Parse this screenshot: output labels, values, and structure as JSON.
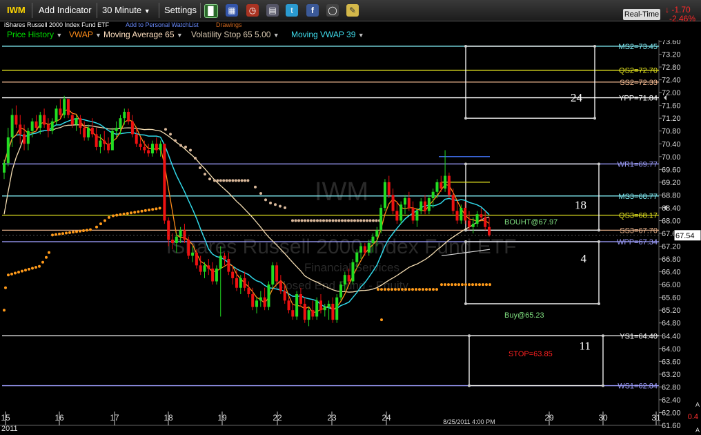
{
  "toolbar": {
    "symbol": "IWM",
    "add_indicator": "Add Indicator",
    "interval": "30 Minute",
    "settings": "Settings",
    "realtime": "Real-Time",
    "change": "-1.70",
    "change_pct": "-2.46%"
  },
  "info": {
    "name": "iShares Russell 2000 Index Fund ETF",
    "watchlist": "Add to Personal WatchList",
    "drawings": "Drawings"
  },
  "indicators": [
    {
      "label": "Price History",
      "color": "#00e000"
    },
    {
      "label": "VWAP",
      "color": "#ff8c1a"
    },
    {
      "label": "Moving Average 65",
      "color": "#ffe0c0"
    },
    {
      "label": "Volatility Stop 65 5.00",
      "color": "#d8c8b0"
    },
    {
      "label": "Moving VWAP 39",
      "color": "#40e0f0"
    }
  ],
  "colors": {
    "up": "#22dd22",
    "down": "#ee1111",
    "vwap": "#ff8c1a",
    "ma": "#f5deb3",
    "mvwap": "#30d8e8",
    "vstop_high": "#d9b89a",
    "vstop_low": "#ff9a1a",
    "cyan": "#7fe8f0",
    "yellow": "#e8e820",
    "peach": "#f0b890",
    "lavender": "#a0a0ff",
    "white": "#ffffff",
    "green_text": "#80e080",
    "stop": "#ff2020"
  },
  "chart_data": {
    "type": "candlestick",
    "symbol": "IWM",
    "watermark": "IWM",
    "watermark_name": "iShares Russell 2000 Index Fund ETF",
    "watermark_sector": "Financial Services",
    "watermark_category": "Closed End Fund - Equity",
    "x_tick_labels": [
      "15",
      "16",
      "17",
      "18",
      "19",
      "22",
      "23",
      "24",
      "29",
      "30",
      "31"
    ],
    "x_tick_year": "2011",
    "current_time_label": "8/25/2011 4:00 PM",
    "ylim": [
      61.6,
      73.6
    ],
    "y_ticks": [
      61.6,
      62.0,
      62.4,
      62.8,
      63.2,
      63.6,
      64.0,
      64.4,
      64.8,
      65.2,
      65.6,
      66.0,
      66.4,
      66.8,
      67.2,
      67.6,
      68.0,
      68.4,
      68.8,
      69.2,
      69.6,
      70.0,
      70.4,
      70.8,
      71.2,
      71.6,
      72.0,
      72.4,
      72.8,
      73.2,
      73.6
    ],
    "last_price": "67.54",
    "right_axis_partial": [
      "0.4",
      "A",
      "A"
    ],
    "levels": [
      {
        "label": "MS2=73.45",
        "value": 73.45,
        "color": "cyan"
      },
      {
        "label": "QS2=72.70",
        "value": 72.7,
        "color": "yellow"
      },
      {
        "label": "SS2=72.33",
        "value": 72.33,
        "color": "peach"
      },
      {
        "label": "YPP=71.84",
        "value": 71.84,
        "color": "white"
      },
      {
        "label": "WR1=69.77",
        "value": 69.77,
        "color": "lavender"
      },
      {
        "label": "MS3=68.77",
        "value": 68.77,
        "color": "cyan"
      },
      {
        "label": "QS3=68.17",
        "value": 68.17,
        "color": "yellow"
      },
      {
        "label": "SS3=67.70",
        "value": 67.7,
        "color": "peach"
      },
      {
        "label": "WPP=67.34",
        "value": 67.34,
        "color": "lavender"
      },
      {
        "label": "YS1=64.40",
        "value": 64.4,
        "color": "white"
      },
      {
        "label": "WS1=62.84",
        "value": 62.84,
        "color": "lavender"
      }
    ],
    "boxes": [
      {
        "number": "24",
        "top": 73.45,
        "bottom": 71.2
      },
      {
        "number": "18",
        "top": 69.77,
        "bottom": 67.7
      },
      {
        "number": "4",
        "top": 67.34,
        "bottom": 65.4
      },
      {
        "number": "11",
        "top": 64.4,
        "bottom": 62.84
      }
    ],
    "annotations": [
      {
        "text": "BOUHT@67.97",
        "price": 67.97,
        "color": "green_text"
      },
      {
        "text": "Buy@65.23",
        "price": 65.23,
        "color": "green_text"
      },
      {
        "text": "STOP=63.85",
        "price": 63.85,
        "color": "stop"
      }
    ],
    "candles": [
      [
        69.5,
        69.9,
        69.3,
        69.8
      ],
      [
        69.8,
        70.9,
        69.7,
        70.6
      ],
      [
        70.6,
        71.5,
        70.3,
        71.3
      ],
      [
        71.3,
        71.6,
        70.9,
        71.0
      ],
      [
        71.0,
        71.3,
        70.4,
        70.7
      ],
      [
        70.7,
        71.0,
        70.2,
        70.4
      ],
      [
        70.4,
        70.9,
        70.2,
        70.8
      ],
      [
        70.8,
        71.2,
        70.6,
        71.1
      ],
      [
        71.1,
        71.3,
        70.8,
        70.9
      ],
      [
        70.9,
        71.4,
        70.7,
        71.3
      ],
      [
        71.3,
        71.5,
        70.9,
        71.0
      ],
      [
        71.0,
        71.2,
        70.6,
        70.8
      ],
      [
        70.8,
        71.2,
        70.7,
        71.1
      ],
      [
        71.1,
        71.6,
        71.0,
        71.5
      ],
      [
        71.5,
        71.8,
        71.2,
        71.3
      ],
      [
        71.3,
        71.9,
        71.2,
        71.8
      ],
      [
        71.8,
        71.8,
        71.2,
        71.3
      ],
      [
        71.3,
        71.4,
        70.9,
        71.0
      ],
      [
        71.0,
        71.3,
        70.8,
        71.2
      ],
      [
        71.2,
        71.3,
        70.7,
        70.9
      ],
      [
        70.9,
        71.1,
        70.5,
        70.6
      ],
      [
        70.6,
        71.0,
        70.5,
        70.9
      ],
      [
        70.9,
        71.2,
        70.6,
        70.7
      ],
      [
        70.7,
        70.9,
        70.2,
        70.3
      ],
      [
        70.3,
        70.7,
        70.1,
        70.5
      ],
      [
        70.5,
        70.8,
        70.2,
        70.4
      ],
      [
        70.4,
        70.6,
        70.1,
        70.2
      ],
      [
        70.2,
        70.9,
        70.2,
        70.8
      ],
      [
        70.8,
        71.1,
        70.6,
        70.9
      ],
      [
        70.9,
        71.3,
        70.7,
        71.2
      ],
      [
        71.2,
        71.5,
        71.0,
        71.4
      ],
      [
        71.4,
        71.5,
        71.0,
        71.1
      ],
      [
        71.1,
        71.3,
        70.6,
        70.7
      ],
      [
        70.7,
        70.9,
        70.3,
        70.4
      ],
      [
        70.4,
        70.6,
        70.2,
        70.3
      ],
      [
        70.3,
        70.5,
        70.1,
        70.2
      ],
      [
        70.2,
        70.4,
        70.0,
        70.1
      ],
      [
        70.1,
        70.5,
        70.0,
        70.4
      ],
      [
        70.4,
        70.6,
        70.1,
        70.2
      ],
      [
        70.2,
        70.5,
        70.0,
        70.4
      ],
      [
        70.4,
        70.4,
        67.9,
        68.0
      ],
      [
        68.0,
        68.1,
        67.2,
        67.4
      ],
      [
        67.4,
        67.6,
        67.1,
        67.3
      ],
      [
        67.3,
        67.6,
        67.0,
        67.5
      ],
      [
        67.5,
        67.8,
        67.3,
        67.7
      ],
      [
        67.7,
        67.9,
        67.3,
        67.4
      ],
      [
        67.4,
        67.5,
        66.8,
        66.9
      ],
      [
        66.9,
        67.2,
        66.7,
        67.0
      ],
      [
        67.0,
        67.1,
        66.5,
        66.6
      ],
      [
        66.6,
        66.9,
        66.3,
        66.4
      ],
      [
        66.4,
        66.7,
        66.2,
        66.6
      ],
      [
        66.6,
        66.8,
        66.3,
        66.5
      ],
      [
        66.5,
        66.7,
        66.0,
        66.1
      ],
      [
        66.1,
        66.6,
        66.0,
        66.5
      ],
      [
        66.5,
        67.2,
        65.0,
        66.9
      ],
      [
        66.9,
        67.0,
        66.6,
        66.8
      ],
      [
        66.8,
        67.0,
        66.3,
        66.4
      ],
      [
        66.4,
        66.6,
        66.0,
        66.2
      ],
      [
        66.2,
        66.5,
        65.8,
        65.9
      ],
      [
        65.9,
        66.3,
        65.7,
        66.2
      ],
      [
        66.2,
        66.4,
        65.8,
        65.9
      ],
      [
        65.9,
        66.1,
        65.6,
        65.7
      ],
      [
        65.7,
        65.9,
        65.2,
        65.3
      ],
      [
        65.3,
        65.6,
        65.1,
        65.5
      ],
      [
        65.5,
        65.8,
        65.3,
        65.6
      ],
      [
        65.6,
        65.9,
        65.2,
        65.3
      ],
      [
        65.3,
        66.1,
        65.2,
        66.0
      ],
      [
        66.0,
        66.7,
        65.9,
        66.6
      ],
      [
        66.6,
        66.7,
        66.0,
        66.1
      ],
      [
        66.1,
        66.3,
        65.7,
        65.8
      ],
      [
        65.8,
        66.0,
        65.4,
        65.5
      ],
      [
        65.5,
        65.6,
        65.1,
        65.2
      ],
      [
        65.2,
        65.4,
        64.9,
        65.0
      ],
      [
        65.0,
        65.8,
        64.9,
        65.7
      ],
      [
        65.7,
        65.9,
        65.3,
        65.4
      ],
      [
        65.4,
        65.6,
        64.8,
        64.9
      ],
      [
        64.9,
        65.3,
        64.7,
        65.2
      ],
      [
        65.2,
        65.5,
        64.9,
        65.0
      ],
      [
        65.0,
        65.6,
        64.9,
        65.5
      ],
      [
        65.5,
        65.7,
        65.1,
        65.2
      ],
      [
        65.2,
        65.4,
        65.0,
        65.3
      ],
      [
        65.3,
        65.5,
        64.9,
        65.4
      ],
      [
        65.4,
        65.6,
        64.8,
        64.9
      ],
      [
        64.9,
        65.7,
        64.8,
        65.6
      ],
      [
        65.6,
        66.1,
        65.5,
        66.0
      ],
      [
        66.0,
        66.4,
        65.8,
        66.3
      ],
      [
        66.3,
        66.5,
        66.0,
        66.1
      ],
      [
        66.1,
        66.8,
        66.0,
        66.7
      ],
      [
        66.7,
        67.1,
        66.5,
        67.0
      ],
      [
        67.0,
        67.3,
        66.8,
        67.2
      ],
      [
        67.2,
        67.3,
        66.9,
        67.0
      ],
      [
        67.0,
        67.4,
        66.9,
        67.3
      ],
      [
        67.3,
        67.6,
        67.0,
        67.5
      ],
      [
        67.5,
        67.8,
        67.2,
        67.7
      ],
      [
        67.7,
        68.5,
        67.6,
        68.4
      ],
      [
        68.4,
        69.3,
        68.3,
        69.2
      ],
      [
        69.2,
        69.4,
        68.7,
        68.8
      ],
      [
        68.8,
        69.0,
        68.2,
        68.3
      ],
      [
        68.3,
        68.6,
        67.9,
        68.0
      ],
      [
        68.0,
        68.6,
        67.9,
        68.5
      ],
      [
        68.5,
        68.8,
        68.2,
        68.7
      ],
      [
        68.7,
        68.9,
        68.3,
        68.4
      ],
      [
        68.4,
        68.6,
        67.9,
        68.0
      ],
      [
        68.0,
        68.4,
        67.8,
        68.3
      ],
      [
        68.3,
        68.7,
        68.2,
        68.6
      ],
      [
        68.6,
        68.8,
        68.2,
        68.3
      ],
      [
        68.3,
        68.8,
        68.2,
        68.7
      ],
      [
        68.7,
        69.0,
        68.4,
        68.9
      ],
      [
        68.9,
        69.3,
        68.7,
        69.2
      ],
      [
        69.2,
        69.4,
        68.9,
        69.0
      ],
      [
        69.0,
        70.2,
        68.9,
        69.4
      ],
      [
        69.4,
        69.5,
        68.7,
        68.8
      ],
      [
        68.8,
        69.0,
        68.2,
        68.3
      ],
      [
        68.3,
        68.6,
        67.9,
        68.0
      ],
      [
        68.0,
        68.5,
        67.9,
        68.4
      ],
      [
        68.4,
        68.6,
        67.9,
        68.0
      ],
      [
        68.0,
        68.3,
        67.7,
        67.8
      ],
      [
        67.8,
        68.1,
        67.6,
        67.9
      ],
      [
        67.9,
        68.3,
        67.8,
        68.2
      ],
      [
        68.2,
        68.4,
        68.0,
        68.1
      ],
      [
        68.1,
        68.3,
        67.7,
        67.8
      ],
      [
        67.8,
        68.1,
        67.5,
        67.54
      ]
    ]
  }
}
